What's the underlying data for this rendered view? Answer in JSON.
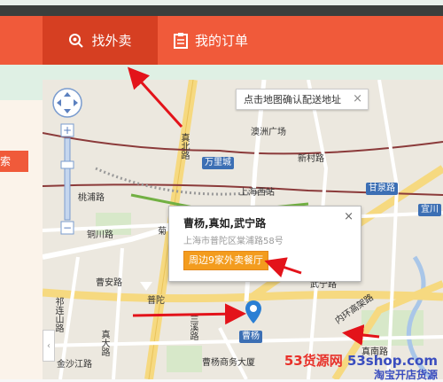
{
  "nav": {
    "tab_takeout": "找外卖",
    "tab_orders": "我的订单"
  },
  "left": {
    "search_button": "索"
  },
  "map": {
    "hint": "点击地图确认配送地址",
    "hint_close": "×",
    "labels": {
      "aozhou": "澳洲广场",
      "wanli": "万里城",
      "xincun": "新村路",
      "shanghai_west": "上海西站",
      "ganquan": "甘泉路",
      "yichuan": "宜川",
      "taoyuan": "桃浦路",
      "tonggu": "铜川路",
      "caoan": "曹安路",
      "zhenbei": "真北路",
      "putuo": "普陀",
      "qilian": "祁连山路",
      "zhenda": "真大路",
      "jinshajiang": "金沙江路",
      "neihuan": "内环高架路",
      "wuning": "武宁路",
      "lanxi": "兰溪路",
      "caoyang_biz": "曹杨商务大厦",
      "caoyang_station": "曹杨",
      "zhennan": "真南路",
      "ju": "菊"
    },
    "popup": {
      "title": "曹杨,真如,武宁路",
      "address": "上海市普陀区棠浦路58号",
      "button": "周边9家外卖餐厅",
      "close": "×"
    },
    "pin_label": "曹杨"
  },
  "watermark": {
    "num": "53",
    "brand": "货源网",
    "site": "53shop.com",
    "slogan": "淘宝开店货源"
  },
  "colors": {
    "nav": "#f05a3a",
    "nav_active": "#d63f22",
    "popup_button": "#f39c1e",
    "pin": "#2a7fd4"
  }
}
